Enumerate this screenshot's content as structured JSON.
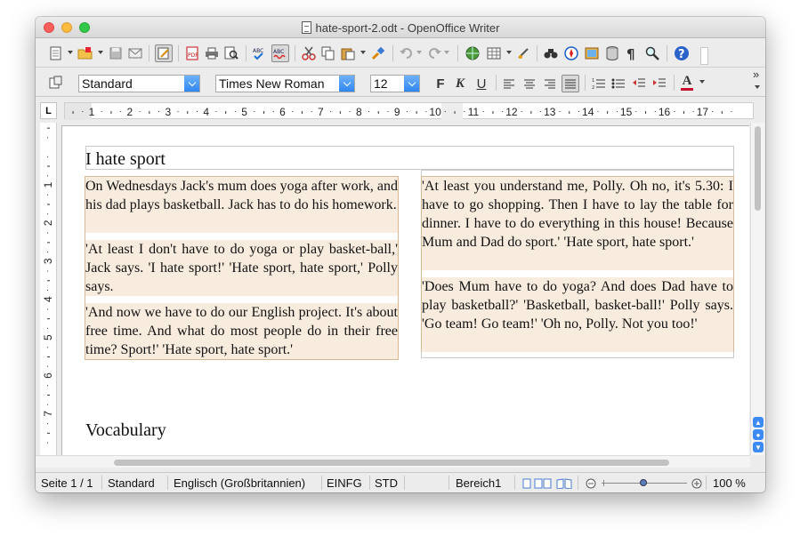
{
  "window": {
    "title": "hate-sport-2.odt - OpenOffice Writer"
  },
  "toolbar": {
    "paragraph_style": "Standard",
    "font_name": "Times New Roman",
    "font_size": "12",
    "bold_label": "F",
    "italic_label": "K",
    "underline_label": "U",
    "font_color_label": "A",
    "overflow_label": "»"
  },
  "ruler": {
    "corner_label": "L",
    "h_ticks": [
      "1",
      "2",
      "3",
      "4",
      "5",
      "6",
      "7",
      "8",
      "9",
      "10",
      "11",
      "12",
      "13",
      "14",
      "15",
      "16",
      "17"
    ],
    "v_ticks": [
      "1",
      "2",
      "3",
      "4",
      "5",
      "6",
      "7"
    ]
  },
  "document": {
    "title": "I hate sport",
    "left_column": [
      "On Wednesdays Jack's mum does yoga after work, and his dad plays basketball. Jack has to do his homework.",
      "'At least I don't have to do yoga or play basket-ball,' Jack says. 'I hate sport!' 'Hate sport, hate sport,' Polly says.",
      "'And now we have to do our English project. It's about free time. And what do most people do in their free time? Sport!' 'Hate sport, hate sport.'"
    ],
    "right_column": [
      "'At least you understand me, Polly. Oh no, it's 5.30: I have to go shopping. Then I have to lay the table for dinner. I have to do everything in this house! Because Mum and Dad do sport.' 'Hate sport, hate sport.'",
      "'Does Mum have to do yoga? And does Dad have to play basketball?' 'Basketball, basket-ball!' Polly says. 'Go team! Go team!' 'Oh no, Polly. Not you too!'"
    ],
    "section_heading": "Vocabulary"
  },
  "statusbar": {
    "page": "Seite 1 / 1",
    "style": "Standard",
    "language": "Englisch (Großbritannien)",
    "insert_mode": "EINFG",
    "selection_mode": "STD",
    "section": "Bereich1",
    "zoom": "100 %"
  },
  "colors": {
    "frame_fill": "#f8ecdf",
    "frame_border": "#d7b892",
    "combo_button": "#2f86f0"
  }
}
